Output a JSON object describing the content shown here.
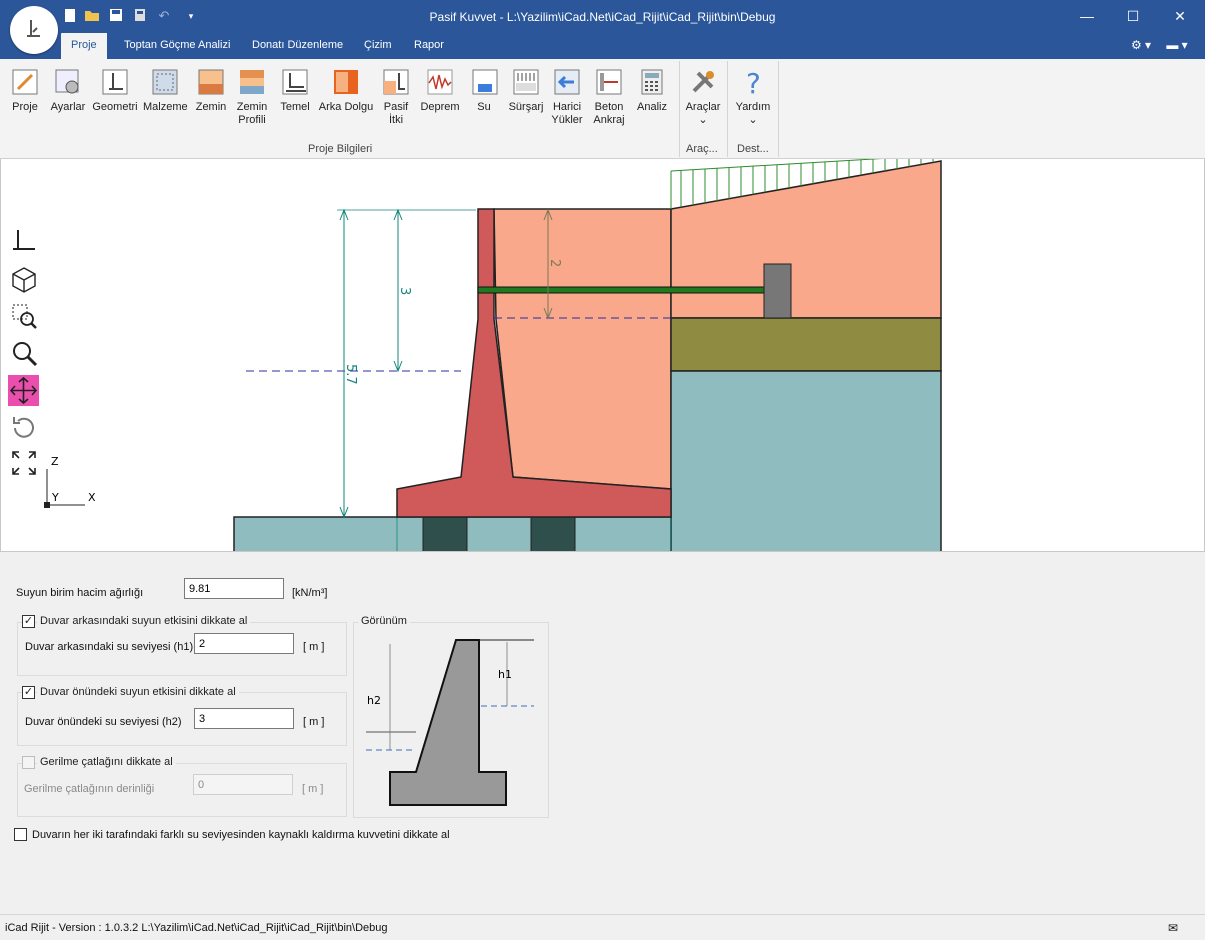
{
  "window": {
    "title": "Pasif Kuvvet - L:\\Yazilim\\iCad.Net\\iCad_Rijit\\iCad_Rijit\\bin\\Debug",
    "min_icon": "minimize-icon",
    "max_icon": "maximize-icon",
    "close_icon": "close-icon"
  },
  "quick_access": [
    "new-file-icon",
    "open-folder-icon",
    "save-icon",
    "save-all-icon",
    "undo-icon",
    "customize-dropdown-icon"
  ],
  "tabs": [
    {
      "label": "Proje",
      "active": true
    },
    {
      "label": "Toptan Göçme Analizi"
    },
    {
      "label": "Donatı Düzenleme"
    },
    {
      "label": "Çizim"
    },
    {
      "label": "Rapor"
    }
  ],
  "ribbon": {
    "buttons": [
      {
        "label": "Proje",
        "icon": "project-icon"
      },
      {
        "label": "Ayarlar",
        "icon": "settings-icon"
      },
      {
        "label": "Geometri",
        "icon": "geometry-icon"
      },
      {
        "label": "Malzeme",
        "icon": "material-icon"
      },
      {
        "label": "Zemin",
        "icon": "soil-icon"
      },
      {
        "label": "Zemin Profili",
        "icon": "soil-profile-icon"
      },
      {
        "label": "Temel",
        "icon": "foundation-icon"
      },
      {
        "label": "Arka Dolgu",
        "icon": "backfill-icon"
      },
      {
        "label": "Pasif İtki",
        "icon": "passive-thrust-icon"
      },
      {
        "label": "Deprem",
        "icon": "earthquake-icon"
      },
      {
        "label": "Su",
        "icon": "water-icon"
      },
      {
        "label": "Sürşarj",
        "icon": "surcharge-icon"
      },
      {
        "label": "Harici Yükler",
        "icon": "external-loads-icon"
      },
      {
        "label": "Beton Ankraj",
        "icon": "concrete-anchor-icon"
      },
      {
        "label": "Analiz",
        "icon": "analysis-icon"
      }
    ],
    "group_label": "Proje Bilgileri",
    "tools": {
      "label": "Araçlar",
      "group": "Araç...",
      "icon": "tools-icon"
    },
    "help": {
      "label": "Yardım",
      "group": "Dest...",
      "icon": "help-icon"
    }
  },
  "drawing": {
    "dim_total": "5.7",
    "dim_h1": "3",
    "dim_anchor": "2",
    "axis_z": "Z",
    "axis_y": "Y",
    "axis_x": "X",
    "colors": {
      "soil": "#f9a88c",
      "wall": "#d05a5a",
      "ground": "#8fbcbf",
      "layer": "#8f8c42",
      "surcharge": "#2e8b2e",
      "dimension": "#12857a",
      "water": "#2c2ca0"
    }
  },
  "form": {
    "unit_weight": {
      "label": "Suyun birim hacim ağırlığı",
      "value": "9.81",
      "unit": "[kN/m³]"
    },
    "behind": {
      "check_label": "Duvar arkasındaki suyun etkisini dikkate al",
      "checked": true,
      "field_label": "Duvar arkasındaki su seviyesi (h1)",
      "value": "2",
      "unit": "[ m ]"
    },
    "front": {
      "check_label": "Duvar önündeki suyun etkisini dikkate al",
      "checked": true,
      "field_label": "Duvar önündeki su seviyesi (h2)",
      "value": "3",
      "unit": "[ m ]"
    },
    "crack": {
      "check_label": "Gerilme çatlağını dikkate al",
      "checked": false,
      "field_label": "Gerilme çatlağının derinliği",
      "value": "0",
      "unit": "[ m ]"
    },
    "uplift": {
      "check_label": "Duvarın her iki tarafındaki farklı su seviyesinden kaynaklı kaldırma kuvvetini dikkate al",
      "checked": false
    },
    "preview": {
      "title": "Görünüm",
      "h1": "h1",
      "h2": "h2"
    }
  },
  "status": {
    "text": "iCad Rijit - Version : 1.0.3.2  L:\\Yazilim\\iCad.Net\\iCad_Rijit\\iCad_Rijit\\bin\\Debug"
  }
}
